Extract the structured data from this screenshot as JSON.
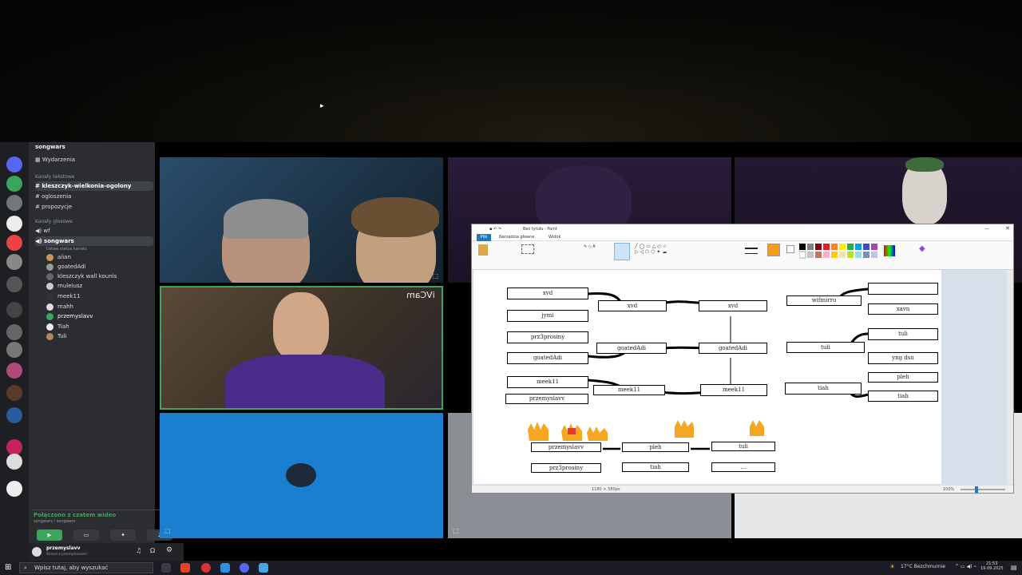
{
  "discord": {
    "server_name": "songwars",
    "events": "Wydarzenia",
    "text_category": "Kanały tekstowe",
    "text_channels": [
      {
        "name": "kleszczyk-wielkonia-ogolony",
        "selected": true
      },
      {
        "name": "ogloszenia",
        "selected": false
      },
      {
        "name": "propozycje",
        "selected": false
      }
    ],
    "voice_category": "Kanały głosowe",
    "voice_channels": [
      {
        "name": "wf",
        "selected": false
      },
      {
        "name": "songwars",
        "selected": true
      }
    ],
    "voice_status": "Ustaw status kanału",
    "voice_members": [
      "aiian",
      "goatedAdi",
      "kleszczyk wall kounis",
      "muleiusz",
      "meek11",
      "mahh",
      "przemyslavv",
      "Tiah",
      "Tuli"
    ],
    "connection_status": "Połączono z czatem wideo",
    "connection_path": "songwars / songwars",
    "user_name": "przemyslavv",
    "user_status": "Stream z przemyslavvem"
  },
  "video": {
    "cam_label": "iVCam"
  },
  "paint": {
    "title": "Bez tytułu - Paint",
    "tabs": [
      "Plik",
      "Narzędzia główne",
      "Widok"
    ],
    "status_size": "1180 × 580px",
    "zoom": "100%",
    "bracket_boxes": [
      "xvd",
      "jymi",
      "prz3prosiny",
      "goatedAdi",
      "meek11",
      "przemyslavv",
      "xvd",
      "goatedAdi",
      "meek11",
      "xvd",
      "goatedAdi",
      "meek11",
      "wifmirro",
      "xavn",
      "tuli",
      "tuli",
      "yng dsu",
      "pleh",
      "tiah",
      "tiah",
      "przemyslavv",
      "prz3prosiny",
      "pleh",
      "tiah",
      "tuli",
      "..."
    ]
  },
  "taskbar": {
    "search_placeholder": "Wpisz tutaj, aby wyszukać",
    "weather": "17°C Bezchmurnie",
    "time": "21:53",
    "date": "19.09.2025"
  }
}
